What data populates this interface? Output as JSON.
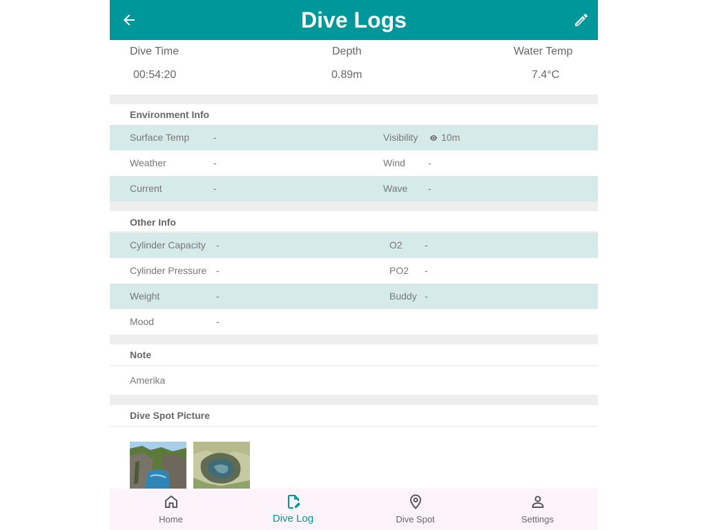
{
  "header": {
    "title": "Dive Logs",
    "back_icon": "arrow-left-icon",
    "edit_icon": "pencil-icon"
  },
  "summary": {
    "dive_time": {
      "label": "Dive Time",
      "value": "00:54:20"
    },
    "depth": {
      "label": "Depth",
      "value": "0.89m"
    },
    "water_temp": {
      "label": "Water Temp",
      "value": "7.4°C"
    }
  },
  "environment": {
    "title": "Environment Info",
    "surface_temp": {
      "label": "Surface Temp",
      "value": "-"
    },
    "visibility": {
      "label": "Visibility",
      "value": "10m",
      "icon": "eye-icon"
    },
    "weather": {
      "label": "Weather",
      "value": "-"
    },
    "wind": {
      "label": "Wind",
      "value": "-"
    },
    "current": {
      "label": "Current",
      "value": "-"
    },
    "wave": {
      "label": "Wave",
      "value": "-"
    }
  },
  "other": {
    "title": "Other Info",
    "cylinder_capacity": {
      "label": "Cylinder Capacity",
      "value": "-"
    },
    "o2": {
      "label": "O2",
      "value": "-"
    },
    "cylinder_pressure": {
      "label": "Cylinder Pressure",
      "value": "-"
    },
    "po2": {
      "label": "PO2",
      "value": "-"
    },
    "weight": {
      "label": "Weight",
      "value": "-"
    },
    "buddy": {
      "label": "Buddy",
      "value": "-"
    },
    "mood": {
      "label": "Mood",
      "value": "-"
    }
  },
  "note": {
    "title": "Note",
    "text": "Amerika"
  },
  "pictures": {
    "title": "Dive Spot Picture"
  },
  "nav": {
    "items": [
      {
        "label": "Home",
        "icon": "home-icon",
        "active": false
      },
      {
        "label": "Dive Log",
        "icon": "edit-document-icon",
        "active": true
      },
      {
        "label": "Dive Spot",
        "icon": "location-pin-icon",
        "active": false
      },
      {
        "label": "Settings",
        "icon": "person-icon",
        "active": false
      }
    ]
  },
  "colors": {
    "primary": "#00979b",
    "row_highlight": "#d7eaea",
    "section_gap": "#eeeeee",
    "nav_background": "#fdf4fb"
  }
}
